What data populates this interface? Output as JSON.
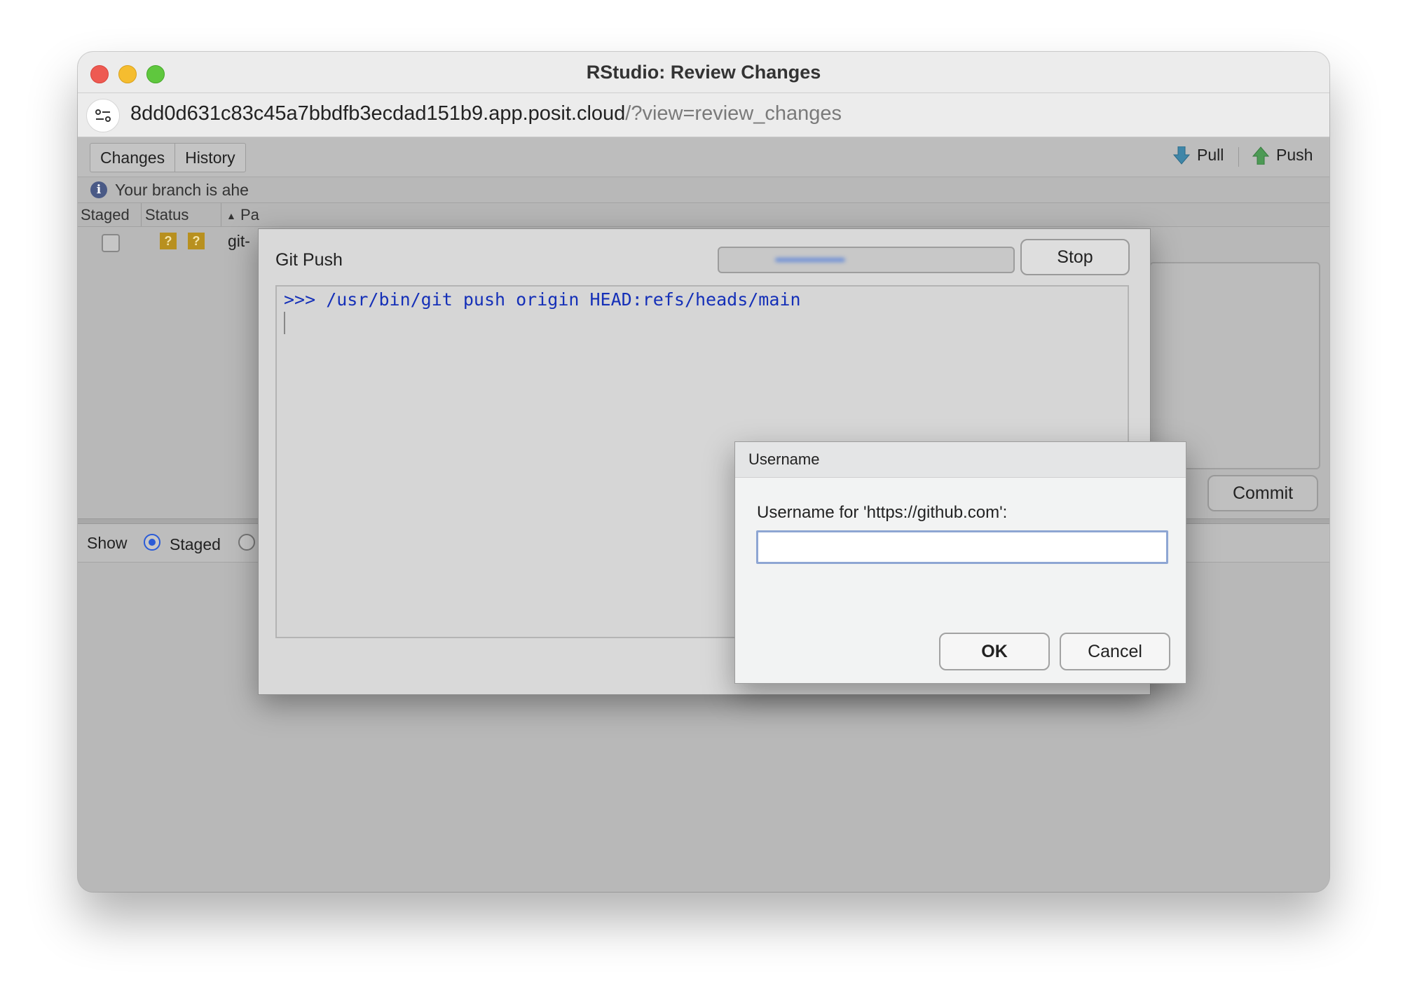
{
  "window": {
    "title": "RStudio: Review Changes"
  },
  "urlbar": {
    "host": "8dd0d631c83c45a7bbdfb3ecdad151b9.app.posit.cloud",
    "path": "/?view=review_changes"
  },
  "review": {
    "tabs": [
      "Changes",
      "History"
    ],
    "pull_label": "Pull",
    "push_label": "Push",
    "info_text": "Your branch is ahe",
    "columns": {
      "staged": "Staged",
      "status": "Status",
      "path": "Pa"
    },
    "file": {
      "status": [
        "?",
        "?"
      ],
      "path": "git-"
    },
    "commit_label": "Commit",
    "show_label": "Show",
    "staged_label": "Staged"
  },
  "git_push": {
    "title": "Git Push",
    "stop_label": "Stop",
    "command": ">>> /usr/bin/git push origin HEAD:refs/heads/main"
  },
  "username_dialog": {
    "title": "Username",
    "prompt": "Username for 'https://github.com':",
    "input_value": "",
    "ok_label": "OK",
    "cancel_label": "Cancel"
  },
  "colors": {
    "accent": "#2a5bd7",
    "console_text": "#1530b8",
    "status_badge": "#b8901f"
  }
}
